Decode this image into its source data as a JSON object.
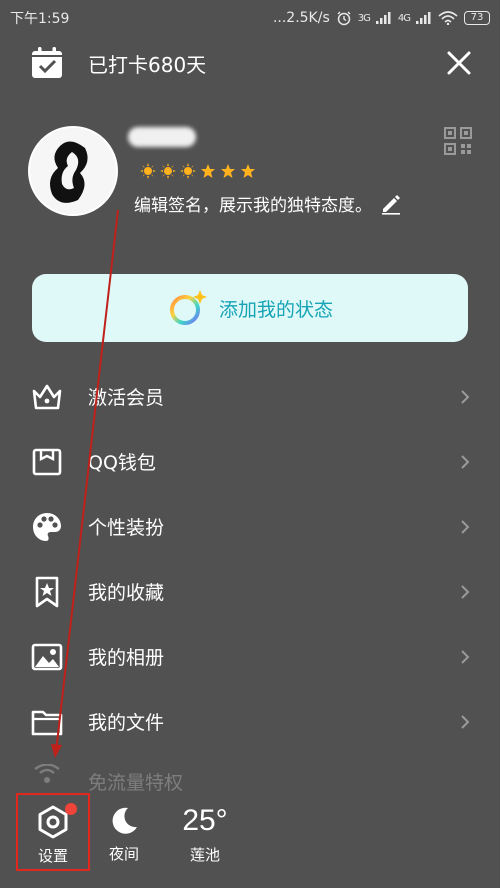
{
  "status_bar": {
    "time": "下午1:59",
    "network_speed": "...2.5K/s",
    "signal_1": "3G",
    "signal_2": "4G",
    "battery": "73"
  },
  "header": {
    "checkin_text": "已打卡680天"
  },
  "profile": {
    "signature": "编辑签名，展示我的独特态度。",
    "level_star_count": 6
  },
  "status_card": {
    "label": "添加我的状态"
  },
  "menu": {
    "items": [
      {
        "label": "激活会员",
        "icon": "crown-icon"
      },
      {
        "label": "QQ钱包",
        "icon": "wallet-icon"
      },
      {
        "label": "个性装扮",
        "icon": "palette-icon"
      },
      {
        "label": "我的收藏",
        "icon": "bookmark-star-icon"
      },
      {
        "label": "我的相册",
        "icon": "photo-icon"
      },
      {
        "label": "我的文件",
        "icon": "folder-icon"
      }
    ],
    "faded_item": {
      "label": "免流量特权",
      "icon": "signal-icon"
    }
  },
  "bottom_bar": {
    "settings_label": "设置",
    "night_label": "夜间",
    "temperature": "25°",
    "city": "莲池"
  },
  "colors": {
    "background": "#515151",
    "status_card_bg": "#dff9f9",
    "status_card_text": "#17a4b5",
    "highlight_box": "#e0281f",
    "notification_dot": "#f0443a"
  }
}
